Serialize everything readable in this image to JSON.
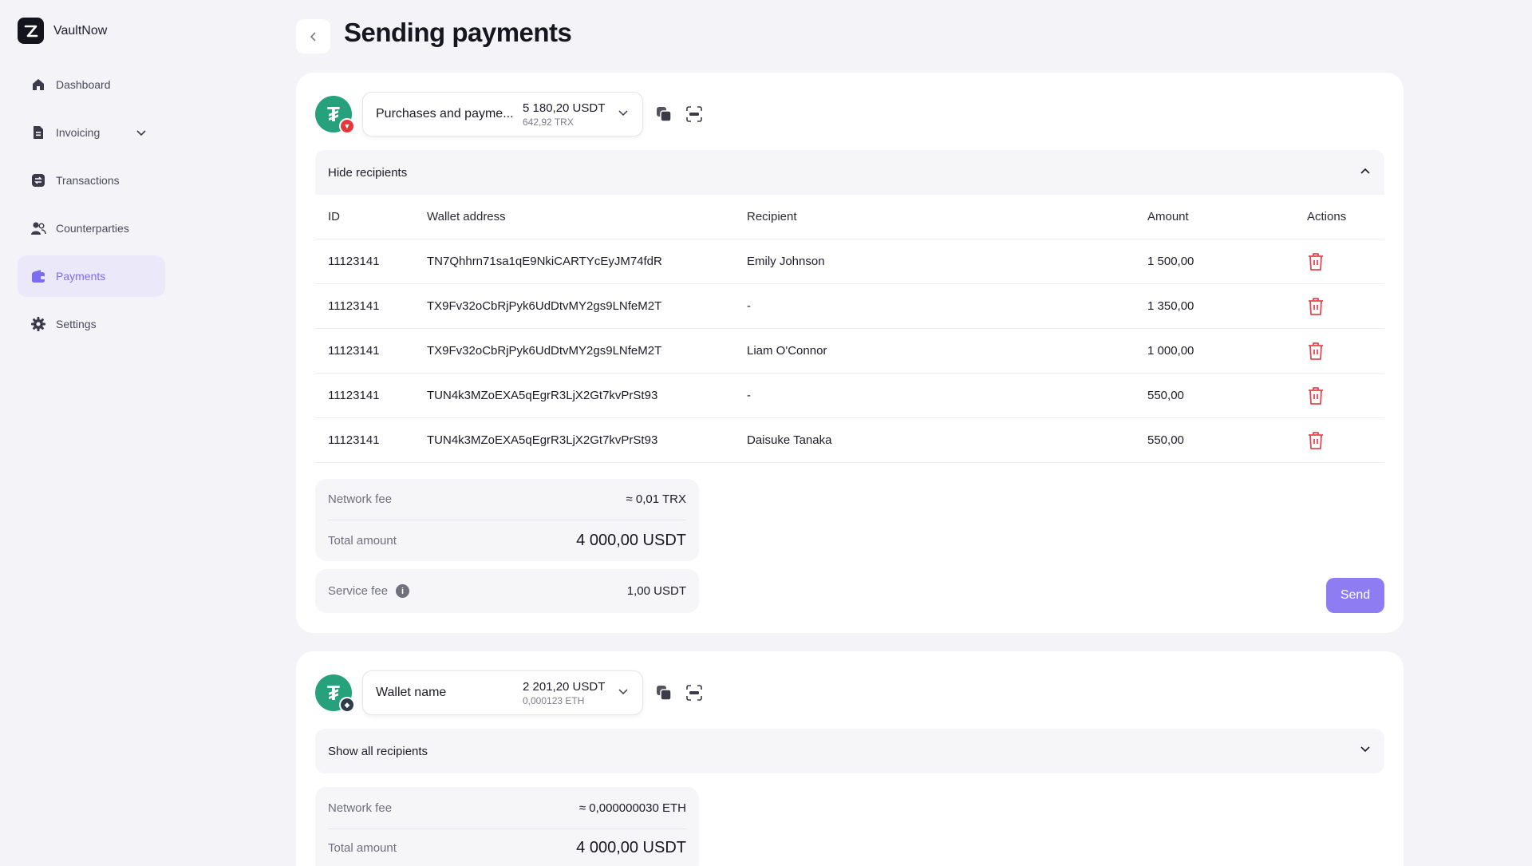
{
  "app": {
    "name": "VaultNow"
  },
  "sidebar": {
    "items": [
      {
        "label": "Dashboard",
        "icon": "home-icon"
      },
      {
        "label": "Invoicing",
        "icon": "document-icon"
      },
      {
        "label": "Transactions",
        "icon": "transactions-icon"
      },
      {
        "label": "Counterparties",
        "icon": "users-icon"
      },
      {
        "label": "Payments",
        "icon": "wallet-icon",
        "active": true
      },
      {
        "label": "Settings",
        "icon": "gear-icon"
      }
    ]
  },
  "header": {
    "title": "Sending payments"
  },
  "cards": [
    {
      "wallet": {
        "name": "Purchases and payme...",
        "balance_main": "5 180,20 USDT",
        "balance_sub": "642,92 TRX"
      },
      "toggle_label": "Hide recipients",
      "table": {
        "headers": {
          "id": "ID",
          "wallet": "Wallet address",
          "recipient": "Recipient",
          "amount": "Amount",
          "actions": "Actions"
        },
        "rows": [
          {
            "id": "11123141",
            "wallet": "TN7Qhhrn71sa1qE9NkiCARTYcEyJM74fdR",
            "recipient": "Emily Johnson",
            "amount": "1 500,00"
          },
          {
            "id": "11123141",
            "wallet": "TX9Fv32oCbRjPyk6UdDtvMY2gs9LNfeM2T",
            "recipient": "-",
            "amount": "1 350,00"
          },
          {
            "id": "11123141",
            "wallet": "TX9Fv32oCbRjPyk6UdDtvMY2gs9LNfeM2T",
            "recipient": "Liam O'Connor",
            "amount": "1 000,00"
          },
          {
            "id": "11123141",
            "wallet": "TUN4k3MZoEXA5qEgrR3LjX2Gt7kvPrSt93",
            "recipient": "-",
            "amount": "550,00"
          },
          {
            "id": "11123141",
            "wallet": "TUN4k3MZoEXA5qEgrR3LjX2Gt7kvPrSt93",
            "recipient": "Daisuke Tanaka",
            "amount": "550,00"
          }
        ]
      },
      "fees": {
        "network_fee_label": "Network fee",
        "network_fee": "≈ 0,01 TRX",
        "total_label": "Total amount",
        "total": "4 000,00 USDT",
        "service_fee_label": "Service fee",
        "service_fee": "1,00 USDT"
      },
      "send_label": "Send"
    },
    {
      "wallet": {
        "name": "Wallet name",
        "balance_main": "2 201,20 USDT",
        "balance_sub": "0,000123 ETH"
      },
      "toggle_label": "Show all recipients",
      "fees": {
        "network_fee_label": "Network fee",
        "network_fee": "≈ 0,000000030 ETH",
        "total_label": "Total amount",
        "total": "4 000,00 USDT"
      }
    }
  ],
  "colors": {
    "accent": "#8e7cf2",
    "active_bg": "#ebe9f9",
    "tether": "#26a17b",
    "danger": "#e5484d"
  }
}
